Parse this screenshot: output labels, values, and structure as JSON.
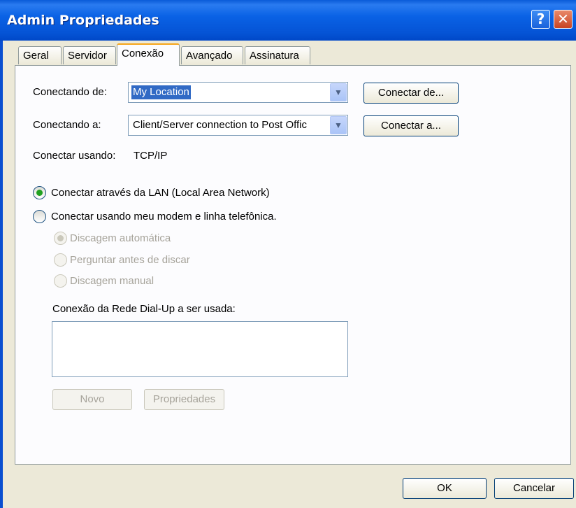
{
  "window": {
    "title": "Admin Propriedades"
  },
  "tabs": [
    {
      "label": "Geral"
    },
    {
      "label": "Servidor"
    },
    {
      "label": "Conexão",
      "active": true
    },
    {
      "label": "Avançado"
    },
    {
      "label": "Assinatura"
    }
  ],
  "from": {
    "label": "Conectando de:",
    "value": "My Location",
    "button": "Conectar de..."
  },
  "to": {
    "label": "Conectando a:",
    "value": "Client/Server connection to Post Offic",
    "button": "Conectar a..."
  },
  "using": {
    "label": "Conectar usando:",
    "value": "TCP/IP"
  },
  "radios": {
    "lan": {
      "label": "Conectar através da LAN (Local Area Network)",
      "checked": true
    },
    "modem": {
      "label": "Conectar usando meu modem e linha telefônica.",
      "checked": false
    }
  },
  "subradios": [
    {
      "label": "Discagem automática",
      "checked": true,
      "enabled": false
    },
    {
      "label": "Perguntar antes de discar",
      "checked": false,
      "enabled": false
    },
    {
      "label": "Discagem manual",
      "checked": false,
      "enabled": false
    }
  ],
  "dialup": {
    "label": "Conexão da Rede Dial-Up a ser usada:",
    "new_button": "Novo",
    "props_button": "Propriedades"
  },
  "footer": {
    "ok": "OK",
    "cancel": "Cancelar"
  },
  "icons": {
    "help": "?",
    "close": "✕",
    "dropdown": "▼"
  },
  "colors": {
    "titlebar": "#0a62e5",
    "selection": "#316ac5",
    "radio_dot": "#21a121",
    "active_tab_accent": "#f5a51a"
  }
}
